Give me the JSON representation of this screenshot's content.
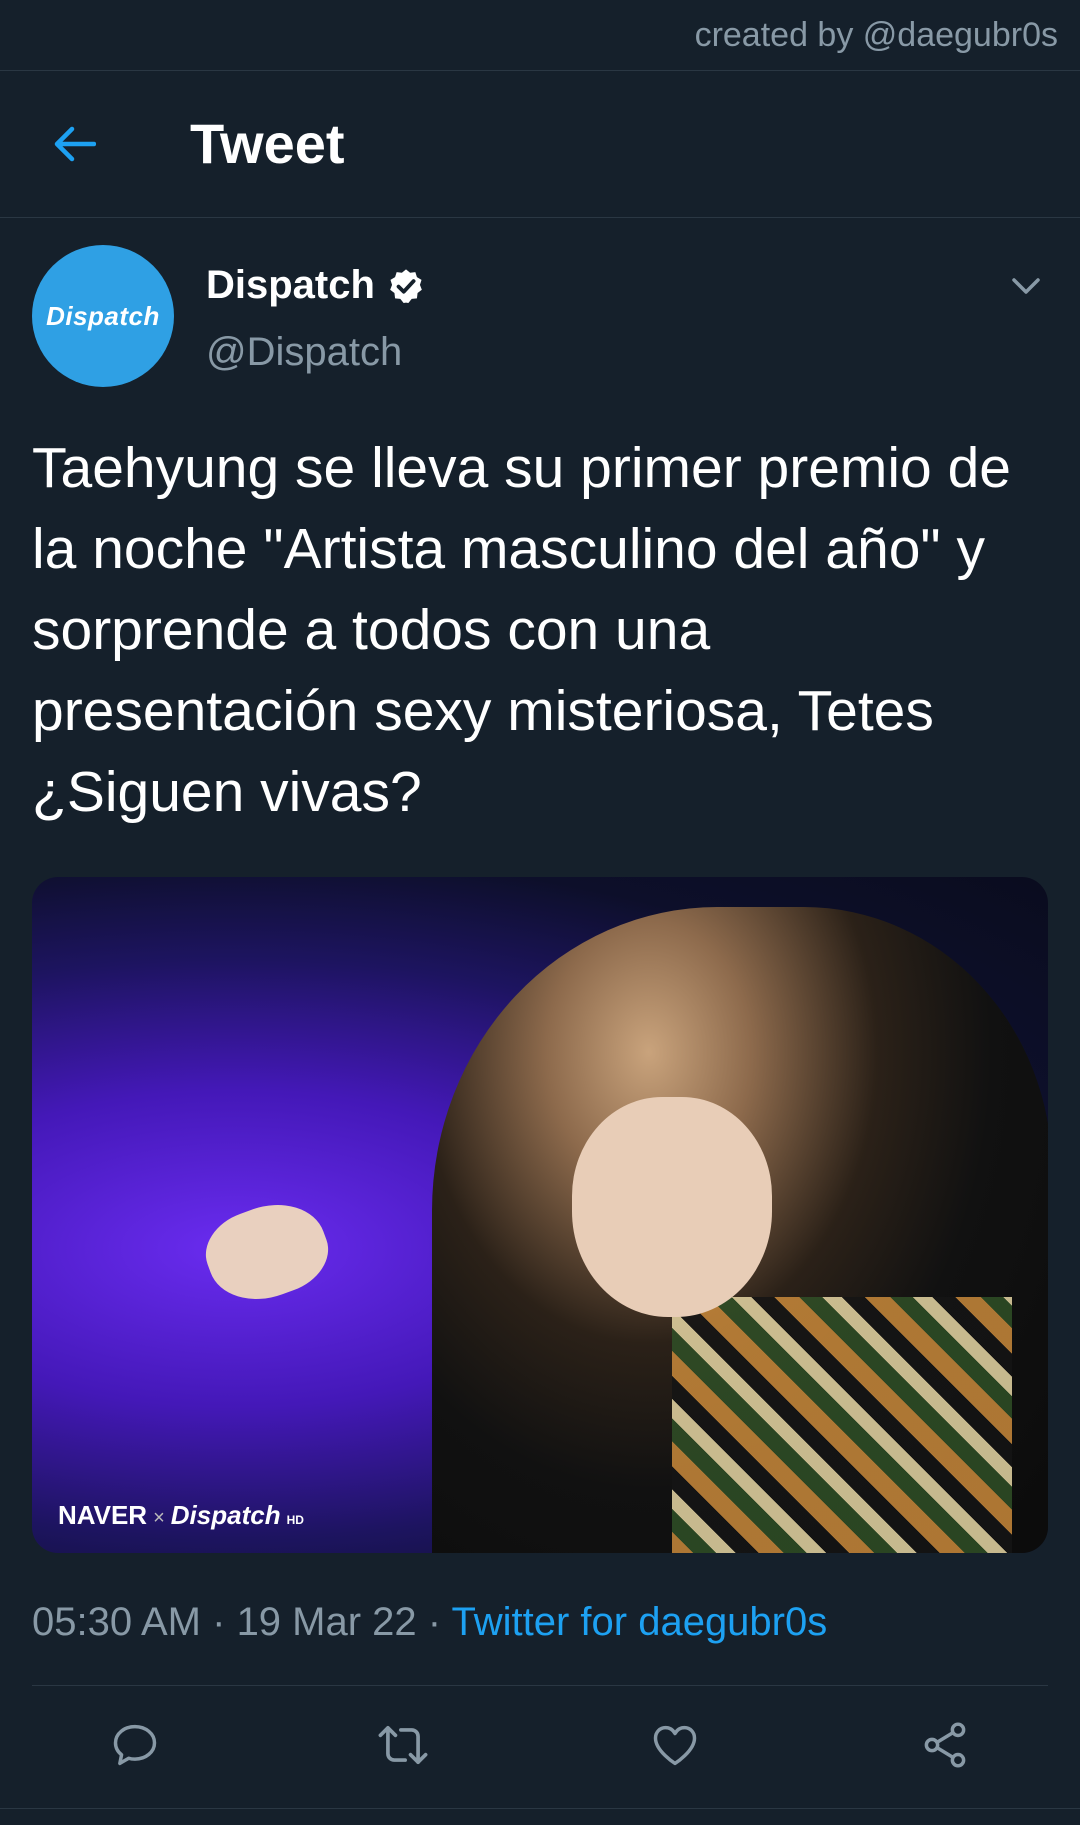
{
  "credit": "created by @daegubr0s",
  "topbar": {
    "title": "Tweet"
  },
  "author": {
    "avatar_text": "Dispatch",
    "name": "Dispatch",
    "handle": "@Dispatch"
  },
  "tweet": {
    "text": "Taehyung se lleva su primer premio de la noche \"Artista masculino del año\" y sorprende a todos con una presentación sexy misteriosa, Tetes ¿Siguen vivas?"
  },
  "media": {
    "watermark_naver": "NAVER",
    "watermark_x": "×",
    "watermark_dispatch": "Dispatch",
    "watermark_hd": "HD"
  },
  "meta": {
    "time": "05:30 AM",
    "sep1": " · ",
    "date": "19 Mar 22",
    "sep2": " · ",
    "source": "Twitter for daegubr0s"
  },
  "colors": {
    "background": "#15202b",
    "accent": "#1da1f2",
    "muted": "#8899a6",
    "avatar": "#2fa0e4"
  },
  "icons": {
    "back": "arrow-left-icon",
    "verified": "verified-badge-icon",
    "caret": "chevron-down-icon",
    "reply": "reply-icon",
    "retweet": "retweet-icon",
    "like": "heart-icon",
    "share": "share-icon"
  }
}
